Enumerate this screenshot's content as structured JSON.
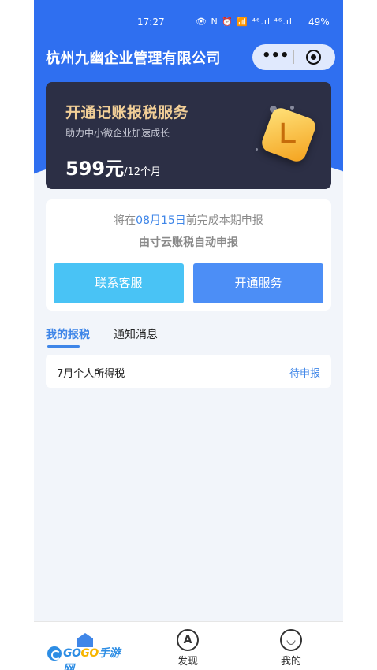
{
  "status_bar": {
    "time": "17:27",
    "icons": "👁 N ⏰ 📶 ⁴⁶.ıl ⁴⁶.ıl",
    "battery": "49%"
  },
  "header": {
    "title": "杭州九幽企业管理有限公司",
    "more_label": "•••",
    "accent_color": "#2f6ff0"
  },
  "promo": {
    "title": "开通记账报税服务",
    "subtitle": "助力中小微企业加速成长",
    "price": "599元",
    "period": "/12个月"
  },
  "notice": {
    "prefix": "将在",
    "date": "08月15日",
    "suffix": "前完成本期申报",
    "auto_text": "由寸云账税自动申报"
  },
  "buttons": {
    "contact": "联系客服",
    "open": "开通服务"
  },
  "tabs": {
    "my_tax": "我的报税",
    "notifications": "通知消息"
  },
  "tax_items": [
    {
      "name": "7月个人所得税",
      "status": "待申报"
    }
  ],
  "tabbar": {
    "discover": "发现",
    "mine": "我的",
    "discover_icon": "A",
    "mine_icon": "◡"
  },
  "watermark": {
    "go": "GO",
    "go2": "GO",
    "site": "手游网"
  }
}
